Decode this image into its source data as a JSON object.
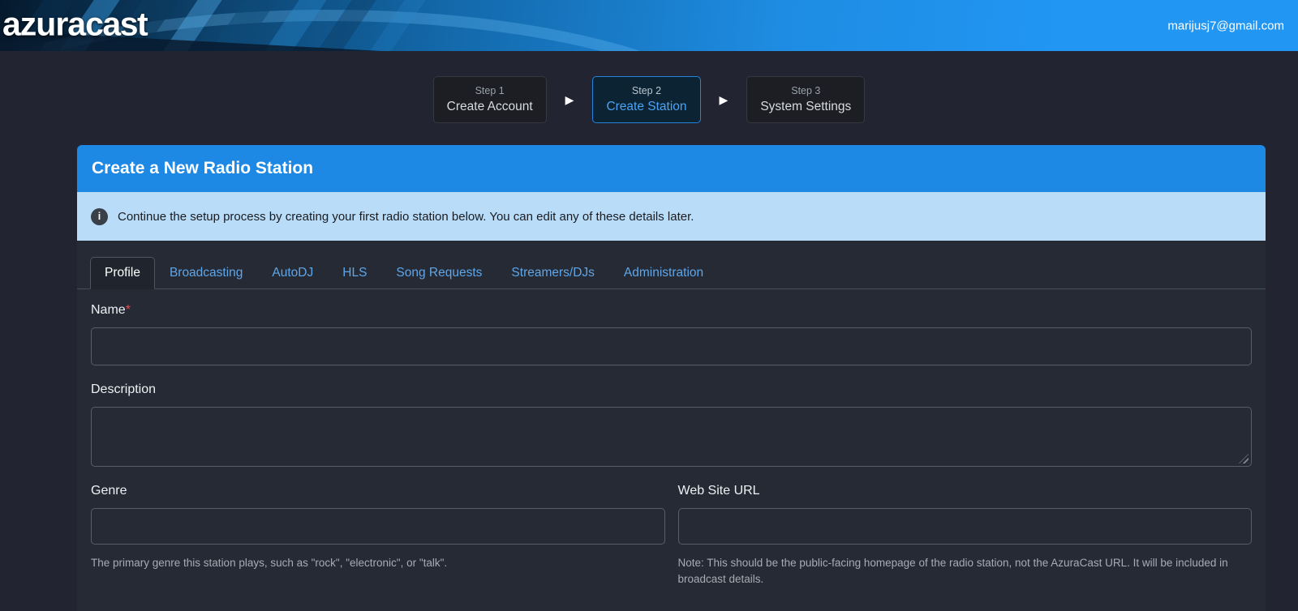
{
  "header": {
    "brand_azura": "azura",
    "brand_cast": "cast",
    "user_email": "marijusj7@gmail.com"
  },
  "stepper": {
    "arrow_icon": "▶",
    "steps": [
      {
        "num": "Step 1",
        "name": "Create Account"
      },
      {
        "num": "Step 2",
        "name": "Create Station"
      },
      {
        "num": "Step 3",
        "name": "System Settings"
      }
    ]
  },
  "card": {
    "title": "Create a New Radio Station",
    "alert": {
      "icon": "i",
      "text": "Continue the setup process by creating your first radio station below. You can edit any of these details later."
    }
  },
  "tabs": [
    {
      "label": "Profile"
    },
    {
      "label": "Broadcasting"
    },
    {
      "label": "AutoDJ"
    },
    {
      "label": "HLS"
    },
    {
      "label": "Song Requests"
    },
    {
      "label": "Streamers/DJs"
    },
    {
      "label": "Administration"
    }
  ],
  "form": {
    "name": {
      "label": "Name",
      "required_marker": "*",
      "value": "",
      "placeholder": ""
    },
    "description": {
      "label": "Description",
      "value": "",
      "placeholder": ""
    },
    "genre": {
      "label": "Genre",
      "value": "",
      "placeholder": "",
      "help": "The primary genre this station plays, such as \"rock\", \"electronic\", or \"talk\"."
    },
    "website": {
      "label": "Web Site URL",
      "value": "",
      "placeholder": "",
      "help": "Note: This should be the public-facing homepage of the radio station, not the AzuraCast URL. It will be included in broadcast details."
    }
  },
  "colors": {
    "page_bg": "#222531",
    "card_bg": "#262a34",
    "header_blue": "#1e88e5",
    "accent_blue": "#2196f3",
    "alert_bg": "#b9dcf8",
    "tab_link_blue": "#5fa6e9",
    "active_step_border": "#2484da",
    "required_red": "#e64c4c"
  }
}
